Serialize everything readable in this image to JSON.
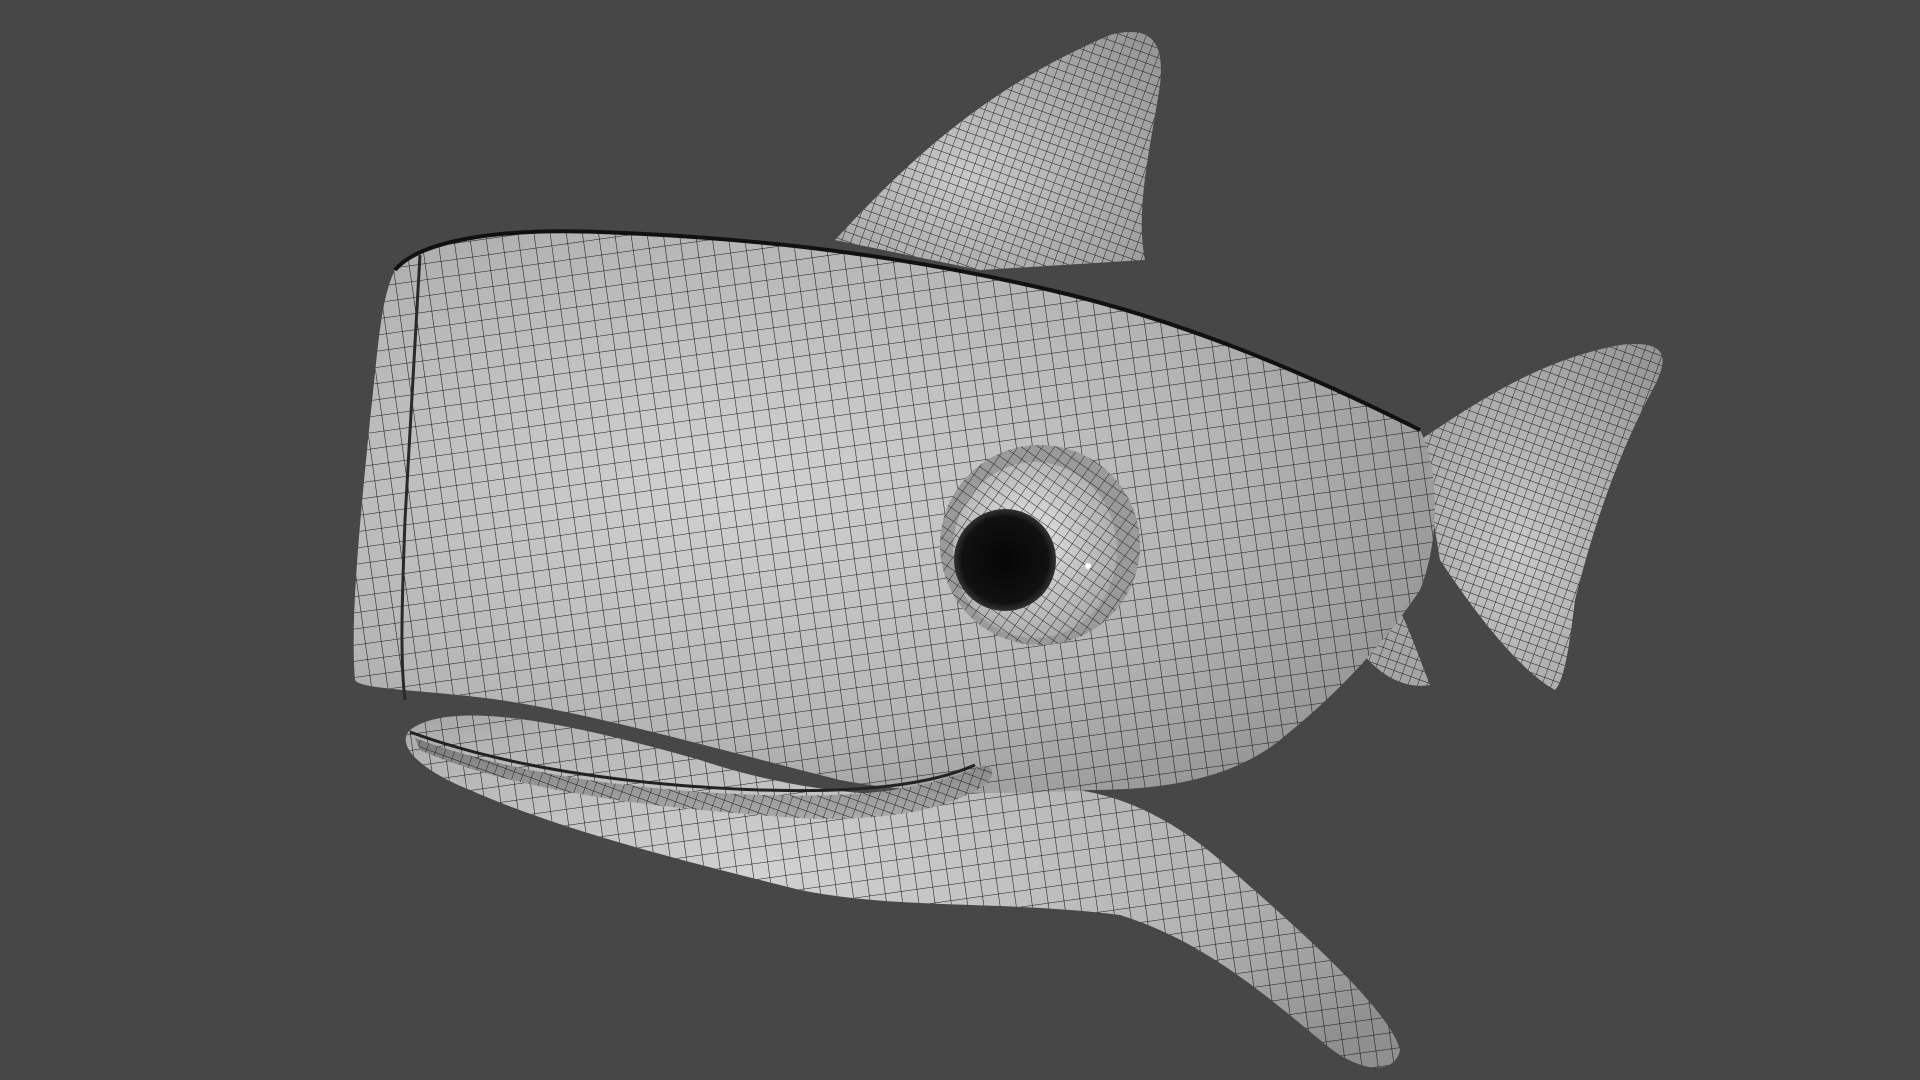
{
  "viewport": {
    "background_color": "#474747",
    "subject": "whale-wireframe-model",
    "shading": "solid-gray-with-wireframe-overlay",
    "mesh_surface_color": "#b9b9b9",
    "wireframe_color": "#1a1a1a",
    "eye_color": "#0e0e0e"
  }
}
